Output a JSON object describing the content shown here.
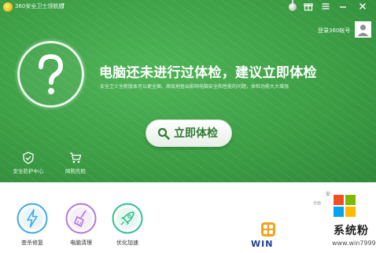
{
  "window": {
    "title": "360安全卫士领航版",
    "login_text": "登录360帐号"
  },
  "hero": {
    "headline": "电脑还未进行过体检，建议立即体检",
    "subline": "安全卫士全新版本可以更全面、高效地查出影响电脑安全和性能的问题，体检功能大大增强",
    "check_button": "立即体检"
  },
  "quick_items": [
    {
      "label": "安全防护中心",
      "icon": "shield-icon"
    },
    {
      "label": "网购先赔",
      "icon": "cart-icon"
    }
  ],
  "tools": [
    {
      "label": "查杀修复",
      "icon": "lightning-icon",
      "color": "#3fa9e6"
    },
    {
      "label": "电脑清理",
      "icon": "broom-icon",
      "color": "#b676d9"
    },
    {
      "label": "优化加速",
      "icon": "rocket-icon",
      "color": "#2fbf8f"
    }
  ],
  "watermark": {
    "left_text": "WIN",
    "brand_name": "系统粉",
    "url": "www.win7999.com",
    "faint_top": "安",
    "faint_sub": "全面"
  },
  "colors": {
    "primary_green": "#3d9f46",
    "button_text": "#2e7d32",
    "flag_red": "#f25022",
    "flag_green": "#7fba00",
    "flag_blue": "#00a4ef",
    "flag_yellow": "#ffb900"
  }
}
